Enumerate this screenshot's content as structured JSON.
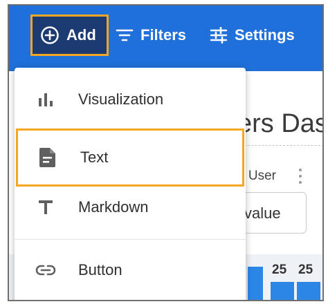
{
  "toolbar": {
    "add_label": "Add",
    "filters_label": "Filters",
    "settings_label": "Settings"
  },
  "background": {
    "title_fragment": "ers Das",
    "label_fragment": "o User",
    "input_fragment": "value",
    "numbers": [
      "25",
      "25"
    ]
  },
  "menu": {
    "items": [
      {
        "label": "Visualization",
        "icon": "bar-chart-icon"
      },
      {
        "label": "Text",
        "icon": "document-icon"
      },
      {
        "label": "Markdown",
        "icon": "text-format-icon"
      },
      {
        "label": "Button",
        "icon": "link-icon"
      }
    ]
  },
  "colors": {
    "toolbar_bg": "#2070db",
    "add_button_bg": "#1c3b73",
    "highlight": "#f5a623",
    "menu_icon": "#5f5f5f",
    "chart_bar": "#2b86e6"
  }
}
